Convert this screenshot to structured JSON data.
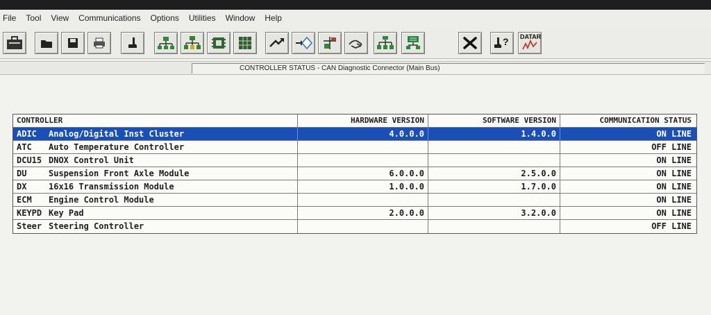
{
  "menu": [
    "File",
    "Tool",
    "View",
    "Communications",
    "Options",
    "Utilities",
    "Window",
    "Help"
  ],
  "toolbar": {
    "buttons": [
      {
        "name": "suitcase-icon"
      },
      {
        "name": "folder-open-icon"
      },
      {
        "name": "save-icon"
      },
      {
        "name": "print-icon"
      },
      {
        "name": "boot-icon"
      },
      {
        "name": "network-connect-icon"
      },
      {
        "name": "network-nodes-icon"
      },
      {
        "name": "module-chip-icon"
      },
      {
        "name": "data-grid-icon"
      },
      {
        "name": "flash-arrow-icon"
      },
      {
        "name": "diamond-signal-icon"
      },
      {
        "name": "bus-config-icon"
      },
      {
        "name": "handshake-icon"
      },
      {
        "name": "network-tree-icon"
      },
      {
        "name": "network-station-icon"
      },
      {
        "name": "tools-icon"
      },
      {
        "name": "help-boot-icon"
      },
      {
        "name": "datar-icon"
      }
    ],
    "datar_label": "DATAR"
  },
  "status_title": "CONTROLLER STATUS  -  CAN Diagnostic Connector (Main Bus)",
  "table": {
    "headers": {
      "controller": "CONTROLLER",
      "hardware": "HARDWARE VERSION",
      "software": "SOFTWARE VERSION",
      "communication": "COMMUNICATION STATUS"
    },
    "rows": [
      {
        "abbr": "ADIC",
        "name": "Analog/Digital Inst Cluster",
        "hardware": "4.0.0.0",
        "software": "1.4.0.0",
        "status": "ON LINE",
        "selected": true
      },
      {
        "abbr": "ATC",
        "name": "Auto Temperature Controller",
        "hardware": "",
        "software": "",
        "status": "OFF LINE"
      },
      {
        "abbr": "DCU15",
        "name": "DNOX Control Unit",
        "hardware": "",
        "software": "",
        "status": "ON LINE"
      },
      {
        "abbr": "DU",
        "name": "Suspension Front Axle Module",
        "hardware": "6.0.0.0",
        "software": "2.5.0.0",
        "status": "ON LINE"
      },
      {
        "abbr": "DX",
        "name": "16x16 Transmission Module",
        "hardware": "1.0.0.0",
        "software": "1.7.0.0",
        "status": "ON LINE"
      },
      {
        "abbr": "ECM",
        "name": "Engine Control Module",
        "hardware": "",
        "software": "",
        "status": "ON LINE"
      },
      {
        "abbr": "KEYPD",
        "name": "Key Pad",
        "hardware": "2.0.0.0",
        "software": "3.2.0.0",
        "status": "ON LINE"
      },
      {
        "abbr": "Steer",
        "name": "Steering Controller",
        "hardware": "",
        "software": "",
        "status": "OFF LINE"
      }
    ]
  },
  "colors": {
    "selection": "#1b4fb8",
    "window": "#f2f2ee"
  }
}
